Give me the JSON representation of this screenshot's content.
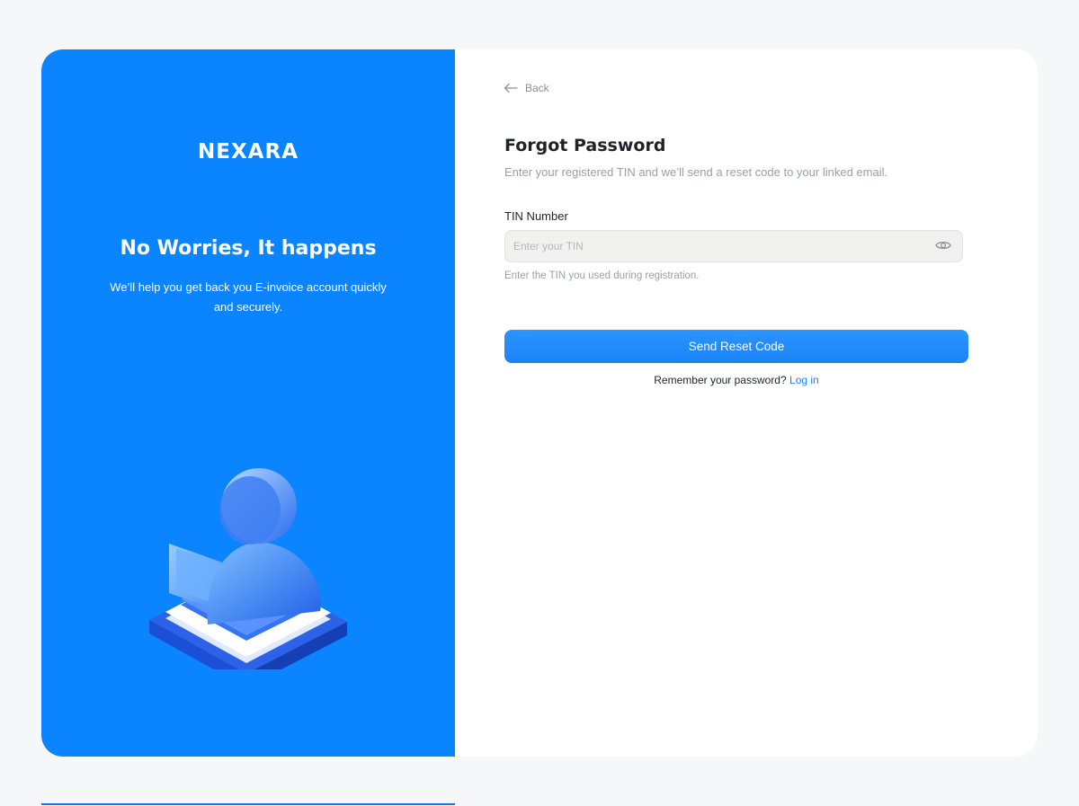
{
  "brand": {
    "name": "NEXARA"
  },
  "hero": {
    "title": "No Worries, It happens",
    "subtitle": "We’ll help you get back you E-invoice account quickly and securely."
  },
  "back": {
    "label": "Back",
    "icon": "arrow-left-icon"
  },
  "form": {
    "title": "Forgot Password",
    "subtitle": "Enter your registered TIN and we’ll send a reset code to your linked email.",
    "tin_label": "TIN Number",
    "tin_value": "",
    "tin_placeholder": "Enter your TIN",
    "tin_toggle_icon": "eye-icon",
    "tin_helper": "Enter the TIN you used during registration.",
    "submit_label": "Send Reset Code",
    "remember_text": "Remember your password?",
    "login_link": "Log in"
  },
  "colors": {
    "brand_blue": "#0a84ff",
    "button_blue": "#1a82f5",
    "link_blue": "#1a82f5",
    "page_bg": "#f6f7f8"
  }
}
